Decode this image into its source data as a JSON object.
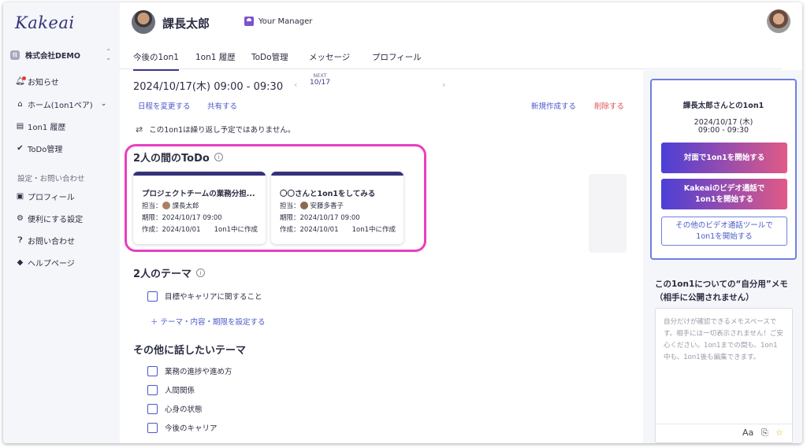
{
  "brand": {
    "logo": "Kakeai"
  },
  "sidebar": {
    "company": "株式会社DEMO",
    "company_icon": "株",
    "items": [
      {
        "label": "お知らせ",
        "icon": "bell-icon"
      },
      {
        "label": "ホーム(1on1ペア)",
        "icon": "home-icon"
      },
      {
        "label": "1on1 履歴",
        "icon": "history-icon"
      },
      {
        "label": "ToDo管理",
        "icon": "check-circle-icon"
      }
    ],
    "section_label": "設定・お問い合わせ",
    "settings": [
      {
        "label": "プロフィール",
        "icon": "profile-icon"
      },
      {
        "label": "便利にする設定",
        "icon": "gear-icon"
      },
      {
        "label": "お問い合わせ",
        "icon": "question-icon"
      },
      {
        "label": "ヘルプページ",
        "icon": "graduation-cap-icon"
      }
    ]
  },
  "header": {
    "user_name": "課長太郎",
    "manager_label": "Your Manager"
  },
  "tabs": [
    "今後の1on1",
    "1on1 履歴",
    "ToDo管理",
    "メッセージ",
    "プロフィール"
  ],
  "session": {
    "date_time": "2024/10/17(木) 09:00 - 09:30",
    "next_label": "NEXT",
    "next_date": "10/17",
    "actions": {
      "reschedule": "日程を変更する",
      "share": "共有する",
      "new": "新規作成する",
      "delete": "削除する"
    },
    "recurrence_note": "この1on1は繰り返し予定ではありません。"
  },
  "todos": {
    "title": "2人の間のToDo",
    "items": [
      {
        "title": "プロジェクトチームの業務分担...",
        "assignee_label": "担当：",
        "assignee": "課長太郎",
        "due": "期限：2024/10/17 09:00",
        "created": "作成：2024/10/01",
        "created_in": "1on1中に作成"
      },
      {
        "title": "〇〇さんと1on1をしてみる",
        "assignee_label": "担当：",
        "assignee": "安藤多香子",
        "due": "期限：2024/10/17 09:00",
        "created": "作成：2024/10/01",
        "created_in": "1on1中に作成"
      }
    ]
  },
  "themes": {
    "title": "2人のテーマ",
    "items": [
      "目標やキャリアに関すること"
    ],
    "add_label": "＋ テーマ・内容・期限を設定する"
  },
  "other_themes": {
    "title": "その他に話したいテーマ",
    "items": [
      "業務の進捗や進め方",
      "人間関係",
      "心身の状態",
      "今後のキャリア"
    ]
  },
  "right_panel": {
    "title": "課長太郎さんとの1on1",
    "date": "2024/10/17 (木)",
    "time": "09:00 - 09:30",
    "btn_face": "対面で1on1を開始する",
    "btn_video_1": "Kakeaiのビデオ通話で",
    "btn_video_2": "1on1を開始する",
    "btn_other_1": "その他のビデオ通話ツールで",
    "btn_other_2": "1on1を開始する",
    "memo_title_1": "この1on1についての“自分用”メモ",
    "memo_title_2": "（相手に公開されません）",
    "memo_placeholder": "自分だけが確認できるメモスペースです。相手には一切表示されません！ご安心ください。1on1までの間も、1on1中も、1on1後も編集できます。",
    "tool_font": "Aa",
    "tool_attach": "⎘",
    "tool_star": "☆"
  },
  "colors": {
    "brand": "#35327a",
    "link": "#4a58c9",
    "danger": "#d9534f",
    "highlight": "#e83fc0",
    "gradient_start": "#4b3fd6",
    "gradient_end": "#e05a86"
  }
}
